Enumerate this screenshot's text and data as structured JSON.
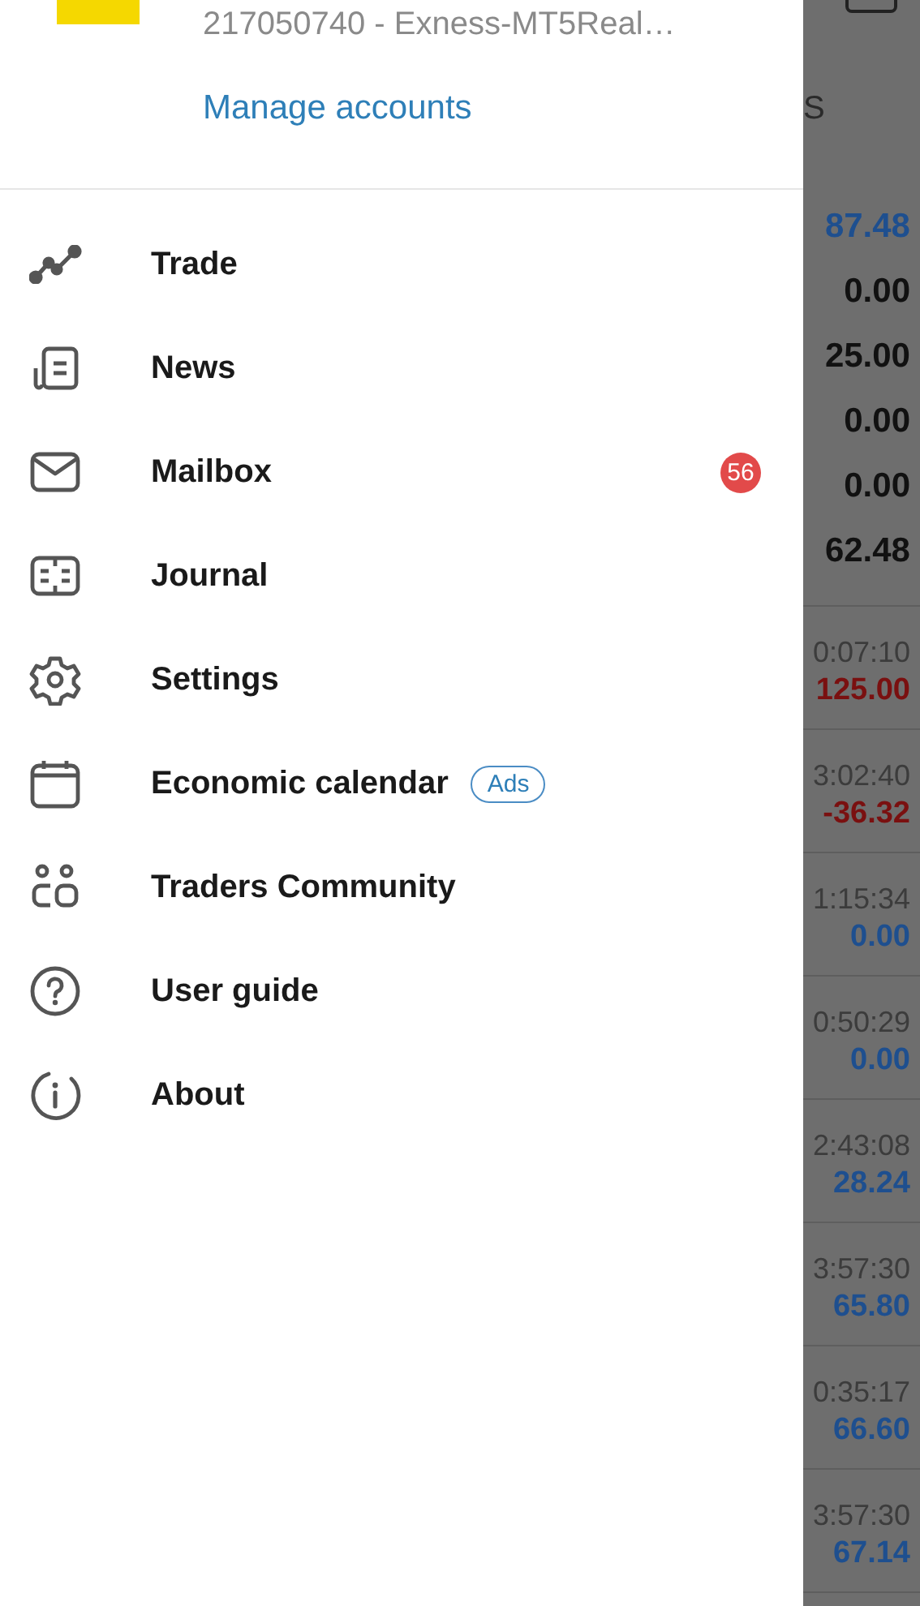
{
  "account": {
    "number": "217050740 - Exness-MT5Real…",
    "manage_link": "Manage accounts"
  },
  "menu": [
    {
      "kind": "trade",
      "label": "Trade"
    },
    {
      "kind": "news",
      "label": "News"
    },
    {
      "kind": "mail",
      "label": "Mailbox",
      "badge": "56"
    },
    {
      "kind": "journal",
      "label": "Journal"
    },
    {
      "kind": "settings",
      "label": "Settings"
    },
    {
      "kind": "calendar",
      "label": "Economic calendar",
      "tag": "Ads"
    },
    {
      "kind": "community",
      "label": "Traders Community"
    },
    {
      "kind": "guide",
      "label": "User guide"
    },
    {
      "kind": "about",
      "label": "About"
    }
  ],
  "background": {
    "header_fragment": "S",
    "summary": [
      {
        "value": "87.48",
        "color": "#1e4f8f"
      },
      {
        "value": "0.00",
        "color": "#111111"
      },
      {
        "value": "25.00",
        "color": "#111111"
      },
      {
        "value": "0.00",
        "color": "#111111"
      },
      {
        "value": "0.00",
        "color": "#111111"
      },
      {
        "value": "62.48",
        "color": "#111111"
      }
    ],
    "positions": [
      {
        "time": "0:07:10",
        "profit": "125.00",
        "color": "#7a1010"
      },
      {
        "time": "3:02:40",
        "profit": "-36.32",
        "color": "#7a1010"
      },
      {
        "time": "1:15:34",
        "profit": "0.00",
        "color": "#1e4f8f"
      },
      {
        "time": "0:50:29",
        "profit": "0.00",
        "color": "#1e4f8f"
      },
      {
        "time": "2:43:08",
        "profit": "28.24",
        "color": "#1e4f8f"
      },
      {
        "time": "3:57:30",
        "profit": "65.80",
        "color": "#1e4f8f"
      },
      {
        "time": "0:35:17",
        "profit": "66.60",
        "color": "#1e4f8f"
      },
      {
        "time": "3:57:30",
        "profit": "67.14",
        "color": "#1e4f8f"
      }
    ]
  }
}
